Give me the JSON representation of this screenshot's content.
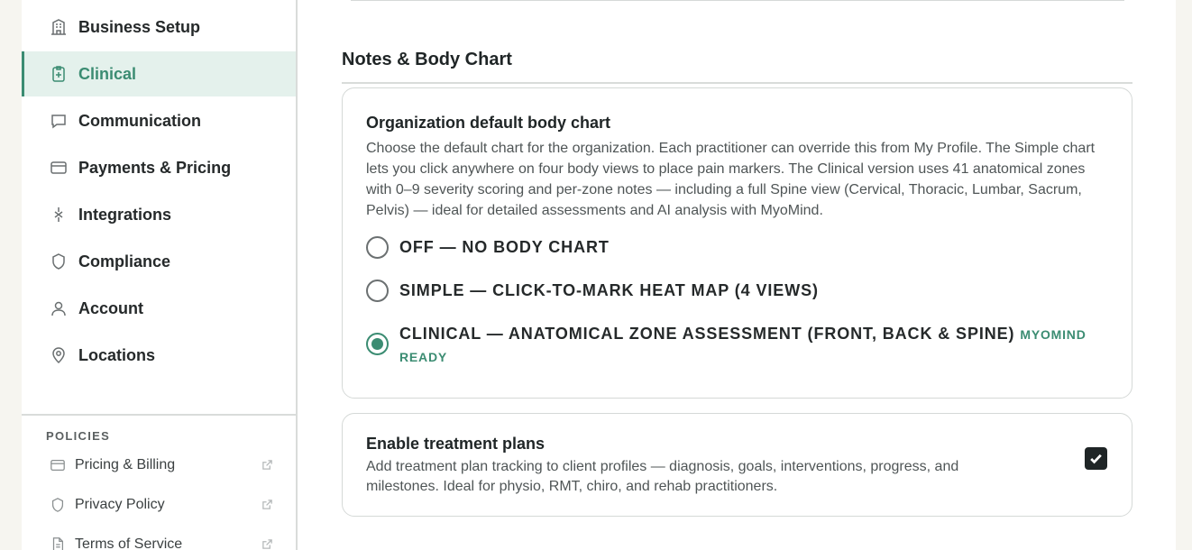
{
  "sidebar": {
    "items": [
      {
        "label": "Business Setup",
        "icon": "building-icon"
      },
      {
        "label": "Clinical",
        "icon": "clipboard-plus-icon"
      },
      {
        "label": "Communication",
        "icon": "chat-bubble-icon"
      },
      {
        "label": "Payments & Pricing",
        "icon": "credit-card-icon"
      },
      {
        "label": "Integrations",
        "icon": "plug-icon"
      },
      {
        "label": "Compliance",
        "icon": "shield-icon"
      },
      {
        "label": "Account",
        "icon": "user-icon"
      },
      {
        "label": "Locations",
        "icon": "map-pin-icon"
      }
    ],
    "active_item": "Clinical",
    "policies_title": "POLICIES",
    "policies": [
      {
        "label": "Pricing & Billing",
        "icon": "credit-card-icon"
      },
      {
        "label": "Privacy Policy",
        "icon": "shield-icon"
      },
      {
        "label": "Terms of Service",
        "icon": "document-icon"
      }
    ]
  },
  "main": {
    "section_title": "Notes & Body Chart",
    "body_chart": {
      "title": "Organization default body chart",
      "description": "Choose the default chart for the organization. Each practitioner can override this from My Profile. The Simple chart lets you click anywhere on four body views to place pain markers. The Clinical version uses 41 anatomical zones with 0–9 severity scoring and per-zone notes — including a full Spine view (Cervical, Thoracic, Lumbar, Sacrum, Pelvis) — ideal for detailed assessments and AI analysis with MyoMind.",
      "options": [
        {
          "label": "OFF — NO BODY CHART",
          "selected": false
        },
        {
          "label": "SIMPLE — CLICK-TO-MARK HEAT MAP (4 VIEWS)",
          "selected": false
        },
        {
          "label": "CLINICAL — ANATOMICAL ZONE ASSESSMENT (FRONT, BACK & SPINE)",
          "badge": "MYOMIND READY",
          "selected": true
        }
      ]
    },
    "treatment_plans": {
      "title": "Enable treatment plans",
      "description": "Add treatment plan tracking to client profiles — diagnosis, goals, interventions, progress, and milestones. Ideal for physio, RMT, chiro, and rehab practitioners.",
      "enabled": true
    }
  },
  "colors": {
    "accent": "#3b8c72",
    "active_bg": "#e4f1ec",
    "page_bg": "#f6f5f0"
  }
}
